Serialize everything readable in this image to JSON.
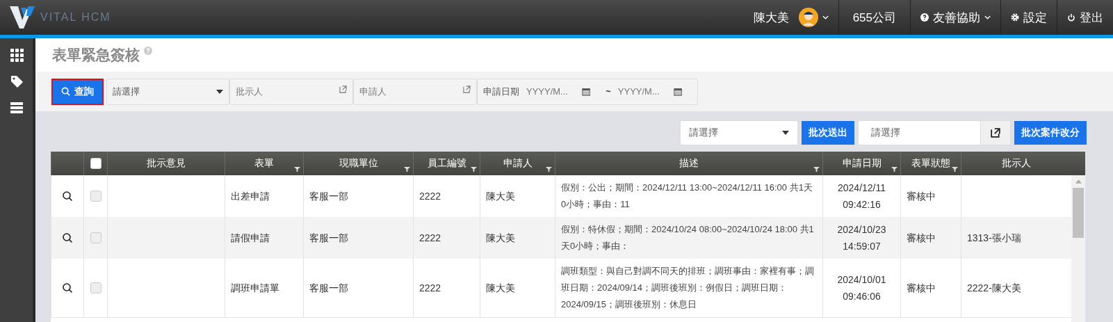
{
  "header": {
    "logo_text": "VITAL HCM",
    "user_name": "陳大美",
    "company": "655公司",
    "help": "友善協助",
    "settings": "設定",
    "logout": "登出"
  },
  "page_title": "表單緊急簽核",
  "filter": {
    "query_button": "查詢",
    "form_select": "請選擇",
    "approver_placeholder": "批示人",
    "applicant_placeholder": "申請人",
    "date_label": "申請日期",
    "date_from_placeholder": "YYYY/M...",
    "date_separator": "~",
    "date_to_placeholder": "YYYY/M..."
  },
  "batch": {
    "select": "請選擇",
    "send_button": "批次送出",
    "assignee_placeholder": "請選擇",
    "reassign_button": "批次案件改分"
  },
  "table": {
    "select_all_checked": false,
    "columns": [
      {
        "label": "批示意見",
        "filter": false
      },
      {
        "label": "表單",
        "filter": true
      },
      {
        "label": "現職單位",
        "filter": true
      },
      {
        "label": "員工編號",
        "filter": true
      },
      {
        "label": "申請人",
        "filter": true
      },
      {
        "label": "描述",
        "filter": true
      },
      {
        "label": "申請日期",
        "filter": true
      },
      {
        "label": "表單狀態",
        "filter": true
      },
      {
        "label": "批示人",
        "filter": false
      }
    ],
    "rows": [
      {
        "checked": false,
        "cells": [
          "",
          "出差申請",
          "客服一部",
          "2222",
          "陳大美",
          "假別：公出；期間：2024/12/11 13:00~2024/12/11 16:00 共1天0小時；事由：11",
          "2024/12/11 09:42:16",
          "審核中",
          ""
        ]
      },
      {
        "checked": false,
        "cells": [
          "",
          "請假申請",
          "客服一部",
          "2222",
          "陳大美",
          "假別：特休假；期間：2024/10/24 08:00~2024/10/24 18:00 共1天0小時；事由：",
          "2024/10/23 14:59:07",
          "審核中",
          "1313-張小瑞"
        ]
      },
      {
        "checked": false,
        "cells": [
          "",
          "調班申請單",
          "客服一部",
          "2222",
          "陳大美",
          "調班類型：與自己對調不同天的排班；調班事由：家裡有事；調班日期：2024/09/14；調班後班別：例假日；調班日期：2024/09/15；調班後班別：休息日",
          "2024/10/01 09:46:06",
          "審核中",
          "2222-陳大美"
        ]
      }
    ]
  }
}
